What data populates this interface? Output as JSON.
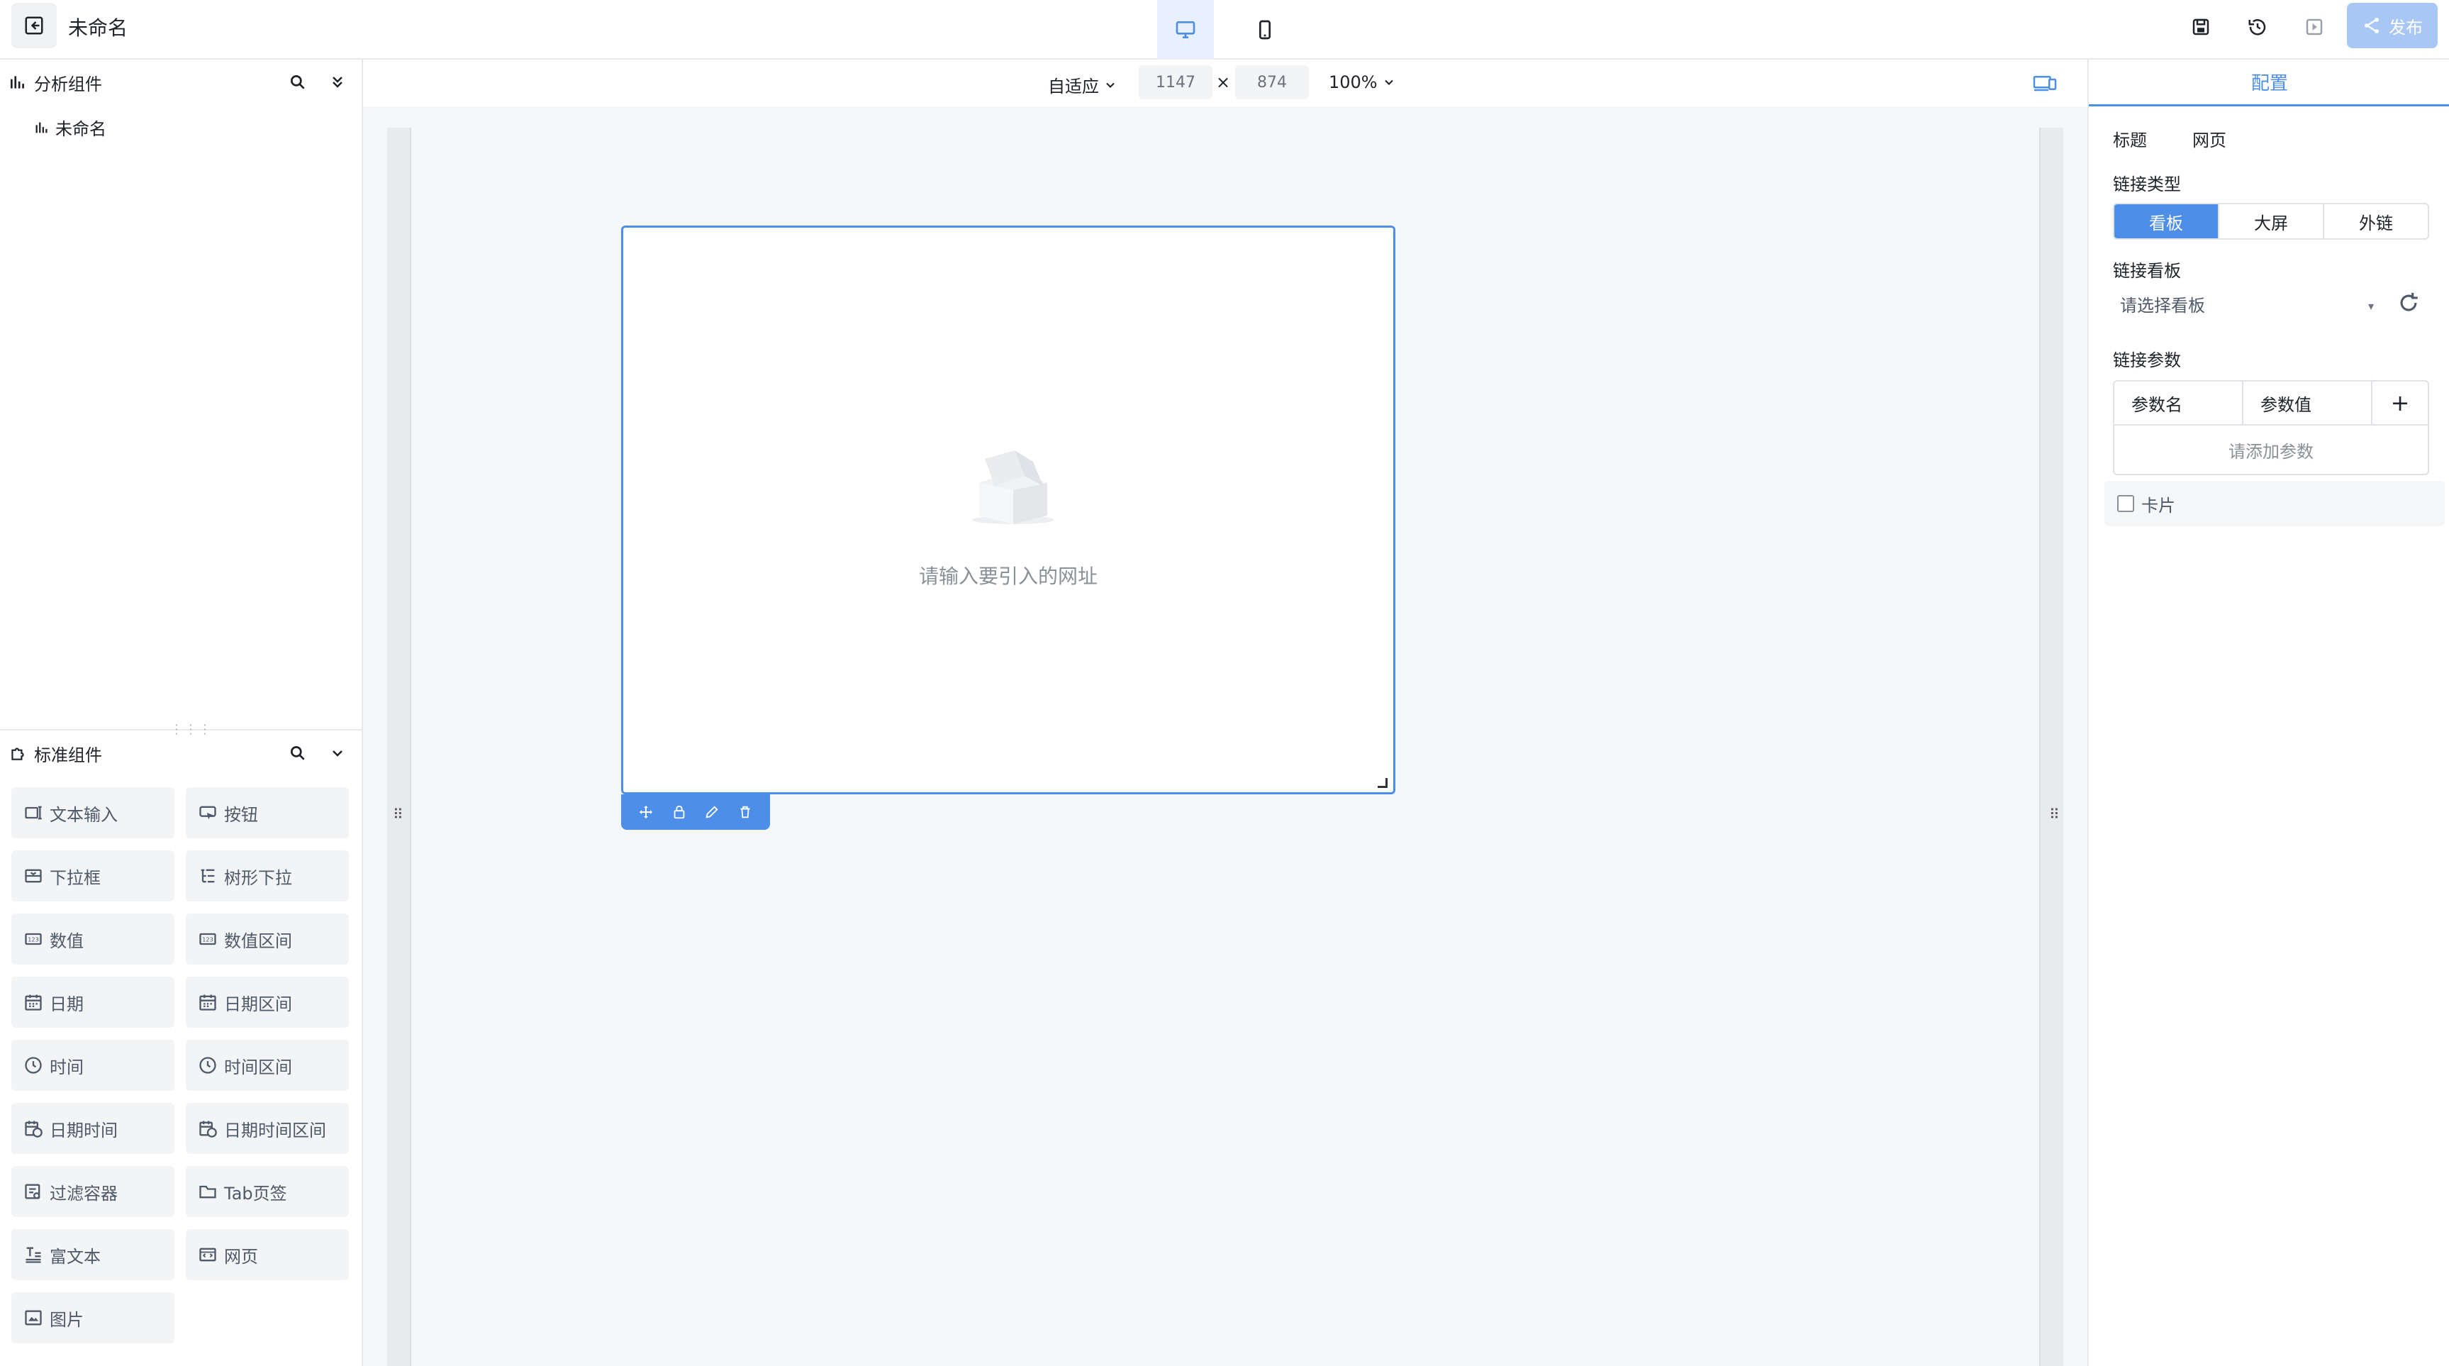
{
  "header": {
    "title": "未命名",
    "publish_label": "发布",
    "accent_color": "#4d8fe8"
  },
  "left_panel": {
    "analysis_section": {
      "title": "分析组件",
      "tree_item": "未命名"
    },
    "standard_section": {
      "title": "标准组件",
      "components": [
        {
          "label": "文本输入",
          "icon": "text-input-icon"
        },
        {
          "label": "按钮",
          "icon": "button-icon"
        },
        {
          "label": "下拉框",
          "icon": "dropdown-icon"
        },
        {
          "label": "树形下拉",
          "icon": "tree-select-icon"
        },
        {
          "label": "数值",
          "icon": "number-icon"
        },
        {
          "label": "数值区间",
          "icon": "number-range-icon"
        },
        {
          "label": "日期",
          "icon": "calendar-icon"
        },
        {
          "label": "日期区间",
          "icon": "calendar-range-icon"
        },
        {
          "label": "时间",
          "icon": "clock-icon"
        },
        {
          "label": "时间区间",
          "icon": "clock-range-icon"
        },
        {
          "label": "日期时间",
          "icon": "datetime-icon"
        },
        {
          "label": "日期时间区间",
          "icon": "datetime-range-icon"
        },
        {
          "label": "过滤容器",
          "icon": "filter-container-icon"
        },
        {
          "label": "Tab页签",
          "icon": "tab-icon"
        },
        {
          "label": "富文本",
          "icon": "rich-text-icon"
        },
        {
          "label": "网页",
          "icon": "webpage-icon"
        },
        {
          "label": "图片",
          "icon": "image-icon"
        }
      ]
    }
  },
  "canvas_toolbar": {
    "fit_mode": "自适应",
    "width": "1147",
    "times": "×",
    "height": "874",
    "zoom": "100%"
  },
  "widget": {
    "empty_text": "请输入要引入的网址"
  },
  "right_panel": {
    "tab": "配置",
    "title_label": "标题",
    "title_value": "网页",
    "link_type_label": "链接类型",
    "link_types": [
      "看板",
      "大屏",
      "外链"
    ],
    "link_type_selected": "看板",
    "link_board_label": "链接看板",
    "link_board_placeholder": "请选择看板",
    "link_params_label": "链接参数",
    "param_name_header": "参数名",
    "param_value_header": "参数值",
    "add_symbol": "+",
    "params_empty": "请添加参数",
    "card_label": "卡片"
  }
}
